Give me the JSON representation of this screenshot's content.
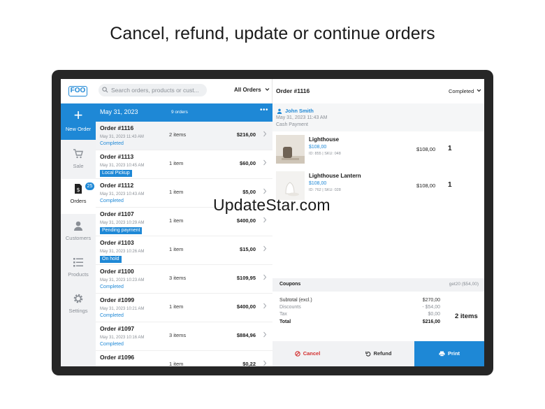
{
  "headline": "Cancel, refund, update or continue orders",
  "watermark": "UpdateStar.com",
  "brand": {
    "logo_text": "FOO",
    "accent_color": "#1e88d6"
  },
  "nav": {
    "new_order_label": "New Order",
    "items": [
      {
        "label": "Sale",
        "icon": "cart-icon"
      },
      {
        "label": "Orders",
        "icon": "orders-icon",
        "badge": "25"
      },
      {
        "label": "Customers",
        "icon": "person-icon"
      },
      {
        "label": "Products",
        "icon": "list-icon"
      },
      {
        "label": "Settings",
        "icon": "gear-icon"
      }
    ]
  },
  "list": {
    "search_placeholder": "Search orders, products or cust...",
    "filter_label": "All Orders",
    "date_header": "May 31, 2023",
    "date_count": "9 orders",
    "more_icon": "•••",
    "orders": [
      {
        "number": "Order #1116",
        "time": "May 31, 2023 11:43 AM",
        "status": "Completed",
        "pill": false,
        "items": "2 items",
        "amount": "$216,00"
      },
      {
        "number": "Order #1113",
        "time": "May 31, 2023 10:45 AM",
        "status": "Local Pickup",
        "pill": true,
        "items": "1 item",
        "amount": "$60,00"
      },
      {
        "number": "Order #1112",
        "time": "May 31, 2023 10:43 AM",
        "status": "Completed",
        "pill": false,
        "items": "1 item",
        "amount": "$5,00"
      },
      {
        "number": "Order #1107",
        "time": "May 31, 2023 10:29 AM",
        "status": "Pending payment",
        "pill": true,
        "items": "1 item",
        "amount": "$400,00"
      },
      {
        "number": "Order #1103",
        "time": "May 31, 2023 10:26 AM",
        "status": "On hold",
        "pill": true,
        "items": "1 item",
        "amount": "$15,00"
      },
      {
        "number": "Order #1100",
        "time": "May 31, 2023 10:23 AM",
        "status": "Completed",
        "pill": false,
        "items": "3 items",
        "amount": "$109,95"
      },
      {
        "number": "Order #1099",
        "time": "May 31, 2023 10:21 AM",
        "status": "Completed",
        "pill": false,
        "items": "1 item",
        "amount": "$400,00"
      },
      {
        "number": "Order #1097",
        "time": "May 31, 2023 10:16 AM",
        "status": "Completed",
        "pill": false,
        "items": "3 items",
        "amount": "$884,96"
      },
      {
        "number": "Order #1096",
        "time": "",
        "status": "",
        "pill": false,
        "items": "1 item",
        "amount": "$0,22"
      }
    ]
  },
  "detail": {
    "title": "Order #1116",
    "status": "Completed",
    "customer": "John Smith",
    "date": "May 31, 2023 11:43 AM",
    "payment": "Cash Payment",
    "products": [
      {
        "name": "Lighthouse",
        "price": "$108,00",
        "meta": "ID: 855 | SKU: 048",
        "total": "$108,00",
        "qty": "1"
      },
      {
        "name": "Lighthouse Lantern",
        "price": "$108,00",
        "meta": "ID: 762 | SKU: 028",
        "total": "$108,00",
        "qty": "1"
      }
    ],
    "coupons_label": "Coupons",
    "coupon_value": "get20 ($54,00)",
    "totals": {
      "subtotal_label": "Subtotal (excl.)",
      "subtotal": "$270,00",
      "discounts_label": "Discounts",
      "discounts": "- $54,00",
      "tax_label": "Tax",
      "tax": "$0,00",
      "total_label": "Total",
      "total": "$216,00"
    },
    "item_count": "2 items",
    "actions": {
      "cancel": "Cancel",
      "refund": "Refund",
      "print": "Print"
    }
  }
}
